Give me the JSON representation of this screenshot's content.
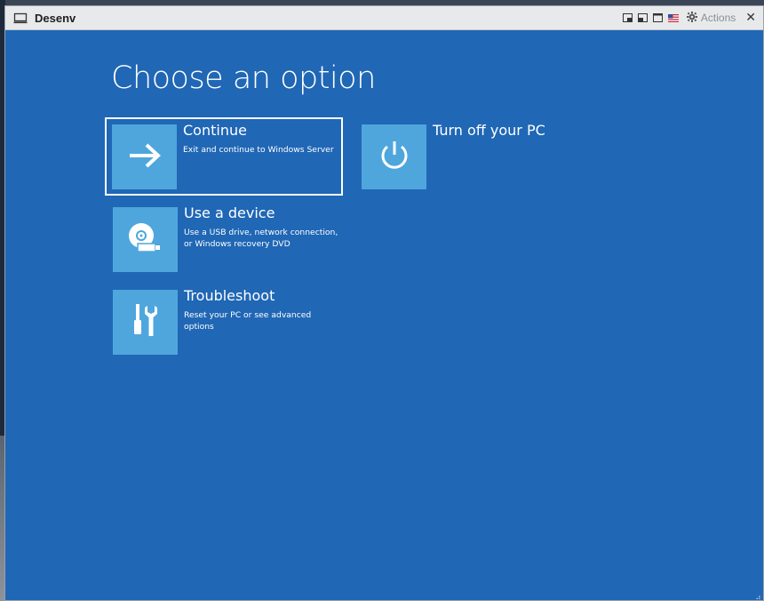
{
  "window": {
    "title": "Desenv",
    "actions_label": "Actions",
    "close_glyph": "✕"
  },
  "screen": {
    "heading": "Choose an option",
    "options": [
      {
        "title": "Continue",
        "description": "Exit and continue to Windows Server",
        "icon": "arrow-right-icon",
        "selected": true
      },
      {
        "title": "Turn off your PC",
        "description": "",
        "icon": "power-icon",
        "selected": false
      },
      {
        "title": "Use a device",
        "description": "Use a USB drive, network connection, or Windows recovery DVD",
        "icon": "disc-usb-icon",
        "selected": false
      },
      {
        "title": "Troubleshoot",
        "description": "Reset your PC or see advanced options",
        "icon": "tools-icon",
        "selected": false
      }
    ]
  },
  "colors": {
    "background_blue": "#2067b5",
    "tile_blue": "#4fa6dd",
    "titlebar": "#e8e9eb"
  }
}
